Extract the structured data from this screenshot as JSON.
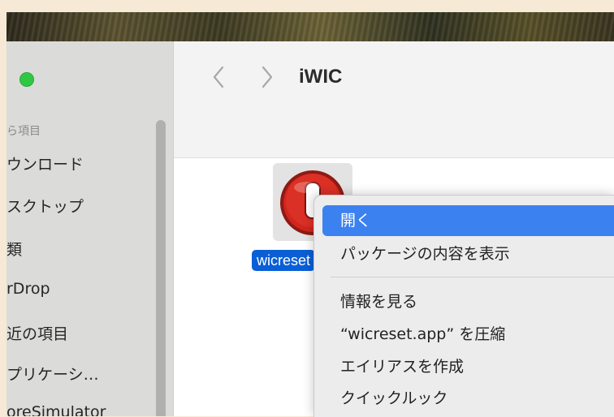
{
  "window": {
    "title": "iWIC"
  },
  "sidebar": {
    "section_header": "ら項目",
    "items": [
      {
        "label": "ウンロード"
      },
      {
        "label": "スクトップ"
      },
      {
        "label": "類"
      },
      {
        "label": "rDrop"
      },
      {
        "label": "近の項目"
      },
      {
        "label": "プリケーシ…"
      },
      {
        "label": "oreSimulator"
      }
    ]
  },
  "file": {
    "label": "wicreset.app",
    "visible_label": "wicreset",
    "icon": "red-power-button-icon"
  },
  "context_menu": {
    "items": [
      {
        "label": "開く",
        "highlighted": true
      },
      {
        "label": "パッケージの内容を表示"
      },
      {
        "label": "情報を見る"
      },
      {
        "label": "“wicreset.app” を圧縮"
      },
      {
        "label": "エイリアスを作成"
      },
      {
        "label": "クイックルック"
      }
    ]
  },
  "colors": {
    "selection_blue": "#0a5fd6",
    "menu_highlight": "#3b82f0",
    "traffic_light_green": "#2fc844",
    "app_icon_red": "#d0261d"
  }
}
